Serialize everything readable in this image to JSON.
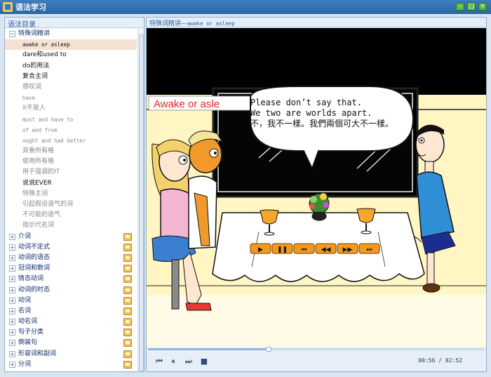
{
  "window": {
    "title": "语法学习",
    "min_icon": "minimize-icon",
    "max_icon": "maximize-icon",
    "close_icon": "close-icon"
  },
  "sidebar": {
    "header": "语法目录",
    "items": [
      {
        "label": "特殊词精讲",
        "level": 0,
        "expanded": true
      },
      {
        "label": "awake or asleep",
        "level": 1,
        "selected": true
      },
      {
        "label": "dare和used to",
        "level": 1
      },
      {
        "label": "do的用法",
        "level": 1
      },
      {
        "label": "复合主词",
        "level": 1
      },
      {
        "label": "感叹词",
        "level": 1
      },
      {
        "label": "have",
        "level": 1
      },
      {
        "label": "it不是人",
        "level": 1
      },
      {
        "label": "must and have to",
        "level": 1
      },
      {
        "label": "of and from",
        "level": 1
      },
      {
        "label": "ought and had better",
        "level": 1
      },
      {
        "label": "双重所有格",
        "level": 1
      },
      {
        "label": "使用所有格",
        "level": 1
      },
      {
        "label": "用于强调的IT",
        "level": 1
      },
      {
        "label": "说说EVER",
        "level": 1
      },
      {
        "label": "特殊主词",
        "level": 1
      },
      {
        "label": "引起假设语气的词",
        "level": 1
      },
      {
        "label": "不可能的语气",
        "level": 1
      },
      {
        "label": "指示代名词",
        "level": 1
      },
      {
        "label": "介词",
        "level": 0
      },
      {
        "label": "动词不定式",
        "level": 0
      },
      {
        "label": "动词的语态",
        "level": 0
      },
      {
        "label": "冠词和数词",
        "level": 0
      },
      {
        "label": "情态动词",
        "level": 0
      },
      {
        "label": "动词的时态",
        "level": 0
      },
      {
        "label": "动词",
        "level": 0
      },
      {
        "label": "名词",
        "level": 0
      },
      {
        "label": "动名词",
        "level": 0
      },
      {
        "label": "句子分类",
        "level": 0
      },
      {
        "label": "倒装句",
        "level": 0
      },
      {
        "label": "形容词和副词",
        "level": 0
      },
      {
        "label": "分词",
        "level": 0
      }
    ]
  },
  "main": {
    "header_prefix": "特殊词精讲—",
    "header_topic": "awake or asleep",
    "video": {
      "caption_title": "Awake or asle",
      "bubble_line1": "Please don’t say that.",
      "bubble_line2": "We two are worlds apart.",
      "bubble_line3": "不，我不一樣。我們兩個可大不一樣。",
      "inner_controls": [
        "play-icon",
        "pause-icon",
        "rewind-start-icon",
        "rewind-icon",
        "fast-forward-icon",
        "skip-end-icon"
      ]
    },
    "progress": 0.358,
    "controls": {
      "time_current": "00:56",
      "time_sep": "/",
      "time_total": "02:52"
    }
  },
  "colors": {
    "title_bar": "#2b64a3",
    "selected_row": "#f4e3d3",
    "caption_red": "#e52a1f",
    "video_bg": "#000000",
    "wall_cream": "#fff6c4"
  }
}
